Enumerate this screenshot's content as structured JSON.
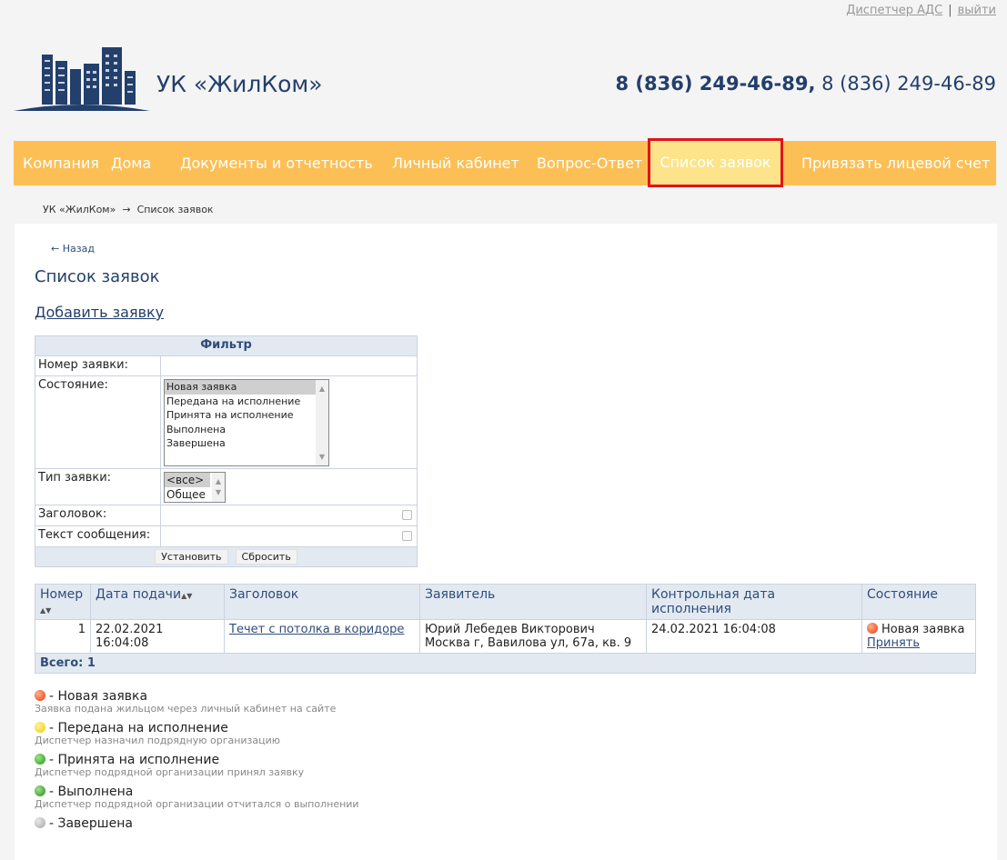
{
  "userbar": {
    "user": "Диспетчер АДС",
    "separator": "|",
    "logout": "выйти"
  },
  "header": {
    "brand": "УК «ЖилКом»",
    "phone_main": "8 (836) 249-46-89,",
    "phone_alt": "8 (836) 249-46-89"
  },
  "nav": [
    {
      "label": "Компания"
    },
    {
      "label": "Дома"
    },
    {
      "label": "Документы и отчетность"
    },
    {
      "label": "Личный кабинет"
    },
    {
      "label": "Вопрос-Ответ"
    },
    {
      "label": "Список заявок",
      "active": true
    },
    {
      "label": "Привязать лицевой счет"
    }
  ],
  "breadcrumb": {
    "home": "УК «ЖилКом»",
    "arrow": "→",
    "current": "Список заявок"
  },
  "page": {
    "back": "← Назад",
    "title": "Список заявок",
    "add_link": "Добавить заявку"
  },
  "filter": {
    "header": "Фильтр",
    "number_label": "Номер заявки:",
    "state_label": "Состояние:",
    "state_options": [
      "Новая заявка",
      "Передана на исполнение",
      "Принята на исполнение",
      "Выполнена",
      "Завершена"
    ],
    "state_selected": "Новая заявка",
    "type_label": "Тип заявки:",
    "type_options": [
      "<все>",
      "Общее"
    ],
    "type_selected": "<все>",
    "subject_label": "Заголовок:",
    "message_label": "Текст сообщения:",
    "apply_button": "Установить",
    "reset_button": "Сбросить"
  },
  "table": {
    "columns": {
      "number": "Номер",
      "date": "Дата подачи",
      "subject": "Заголовок",
      "applicant": "Заявитель",
      "deadline": "Контрольная дата исполнения",
      "state": "Состояние"
    },
    "rows": [
      {
        "number": "1",
        "date": "22.02.2021 16:04:08",
        "subject": "Течет с потолка в коридоре",
        "applicant": "Юрий Лебедев Викторович",
        "address": "Москва г, Вавилова ул, 67а, кв. 9",
        "deadline": "24.02.2021 16:04:08",
        "state": "Новая заявка",
        "action": "Принять"
      }
    ],
    "total": "Всего: 1"
  },
  "legend": [
    {
      "name": "- Новая заявка",
      "desc": "Заявка подана жильцом через личный кабинет на сайте",
      "icon": "red-dot-icon"
    },
    {
      "name": "- Передана на исполнение",
      "desc": "Диспетчер назначил подрядную организацию",
      "icon": "yellow-dot-icon"
    },
    {
      "name": "- Принята на исполнение",
      "desc": "Диспетчер подрядной организации принял заявку",
      "icon": "green-dot-icon"
    },
    {
      "name": "- Выполнена",
      "desc": "Диспетчер подрядной организации отчитался о выполнении",
      "icon": "green-dollar-dot-icon"
    },
    {
      "name": "- Завершена",
      "desc": "",
      "icon": "gray-dot-icon"
    }
  ],
  "colors": {
    "nav": "#fcbf55",
    "nav_active": "#fde48a",
    "active_border": "#e0151a",
    "brand": "#233f6c"
  }
}
